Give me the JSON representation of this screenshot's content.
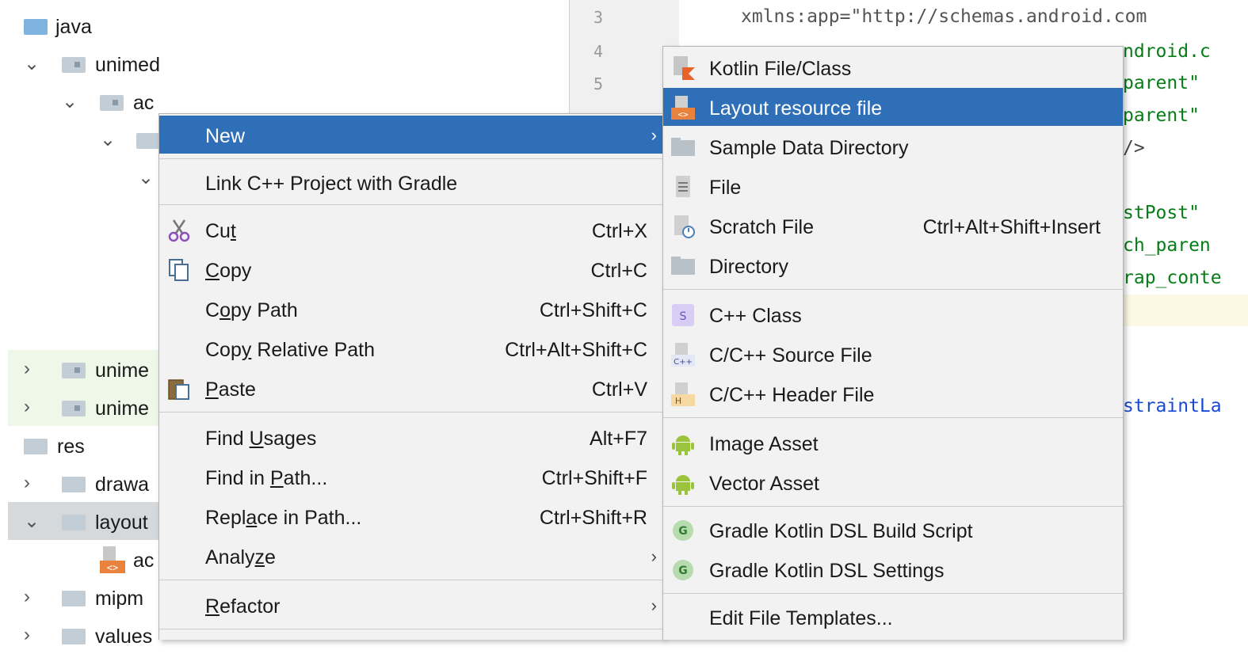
{
  "tree": {
    "rows": [
      {
        "label": "java",
        "chevron": ""
      },
      {
        "label": "unimed",
        "chevron": "⌄"
      },
      {
        "label": "ac",
        "chevron": "⌄"
      },
      {
        "label": "",
        "chevron": "⌄"
      },
      {
        "label": "",
        "chevron": "⌄"
      },
      {
        "label": "unime",
        "chevron": "›"
      },
      {
        "label": "unime",
        "chevron": "›"
      },
      {
        "label": "res",
        "chevron": ""
      },
      {
        "label": "drawa",
        "chevron": "›"
      },
      {
        "label": "layout",
        "chevron": "⌄"
      },
      {
        "label": "ac",
        "chevron": ""
      },
      {
        "label": "mipm",
        "chevron": "›"
      },
      {
        "label": "values",
        "chevron": "›"
      }
    ]
  },
  "gutter": {
    "lines": [
      "3",
      "4",
      "5"
    ]
  },
  "code": {
    "lines": [
      "xmlns:app=\"http://schemas.android.com",
      "ndroid.c",
      "parent\"",
      "parent\"",
      "/>",
      "stPost\"",
      "ch_paren",
      "rap_conte",
      "straintLa"
    ]
  },
  "context_menu": {
    "new_label": "New",
    "link_cpp": "Link C++ Project with Gradle",
    "cut": {
      "pre": "Cu",
      "u": "t",
      "post": "",
      "shortcut": "Ctrl+X"
    },
    "copy": {
      "pre": "",
      "u": "C",
      "post": "opy",
      "shortcut": "Ctrl+C"
    },
    "copy_path": {
      "pre": "C",
      "u": "o",
      "post": "py Path",
      "shortcut": "Ctrl+Shift+C"
    },
    "copy_relative_path": {
      "pre": "Cop",
      "u": "y",
      "post": " Relative Path",
      "shortcut": "Ctrl+Alt+Shift+C"
    },
    "paste": {
      "pre": "",
      "u": "P",
      "post": "aste",
      "shortcut": "Ctrl+V"
    },
    "find_usages": {
      "pre": "Find ",
      "u": "U",
      "post": "sages",
      "shortcut": "Alt+F7"
    },
    "find_in_path": {
      "pre": "Find in ",
      "u": "P",
      "post": "ath...",
      "shortcut": "Ctrl+Shift+F"
    },
    "replace_in_path": {
      "pre": "Repl",
      "u": "a",
      "post": "ce in Path...",
      "shortcut": "Ctrl+Shift+R"
    },
    "analyze": {
      "pre": "Analy",
      "u": "z",
      "post": "e"
    },
    "refactor": {
      "pre": "",
      "u": "R",
      "post": "efactor"
    }
  },
  "submenu": {
    "kotlin_file": "Kotlin File/Class",
    "layout_resource": "Layout resource file",
    "sample_data": "Sample Data Directory",
    "file": "File",
    "scratch_file": "Scratch File",
    "scratch_shortcut": "Ctrl+Alt+Shift+Insert",
    "directory": "Directory",
    "cpp_class": "C++ Class",
    "cpp_source": "C/C++ Source File",
    "cpp_header": "C/C++ Header File",
    "image_asset": "Image Asset",
    "vector_asset": "Vector Asset",
    "gradle_build": "Gradle Kotlin DSL Build Script",
    "gradle_settings": "Gradle Kotlin DSL Settings",
    "edit_templates": "Edit File Templates...",
    "badges": {
      "s": "S",
      "cpp": "C++",
      "h": "H",
      "g": "G",
      "xml": "<>"
    }
  },
  "colors": {
    "selection": "#2f6fb8",
    "menu_bg": "#f2f2f2",
    "code_string": "#067d17",
    "code_attr": "#174ad4",
    "android_green": "#9cc33c"
  }
}
